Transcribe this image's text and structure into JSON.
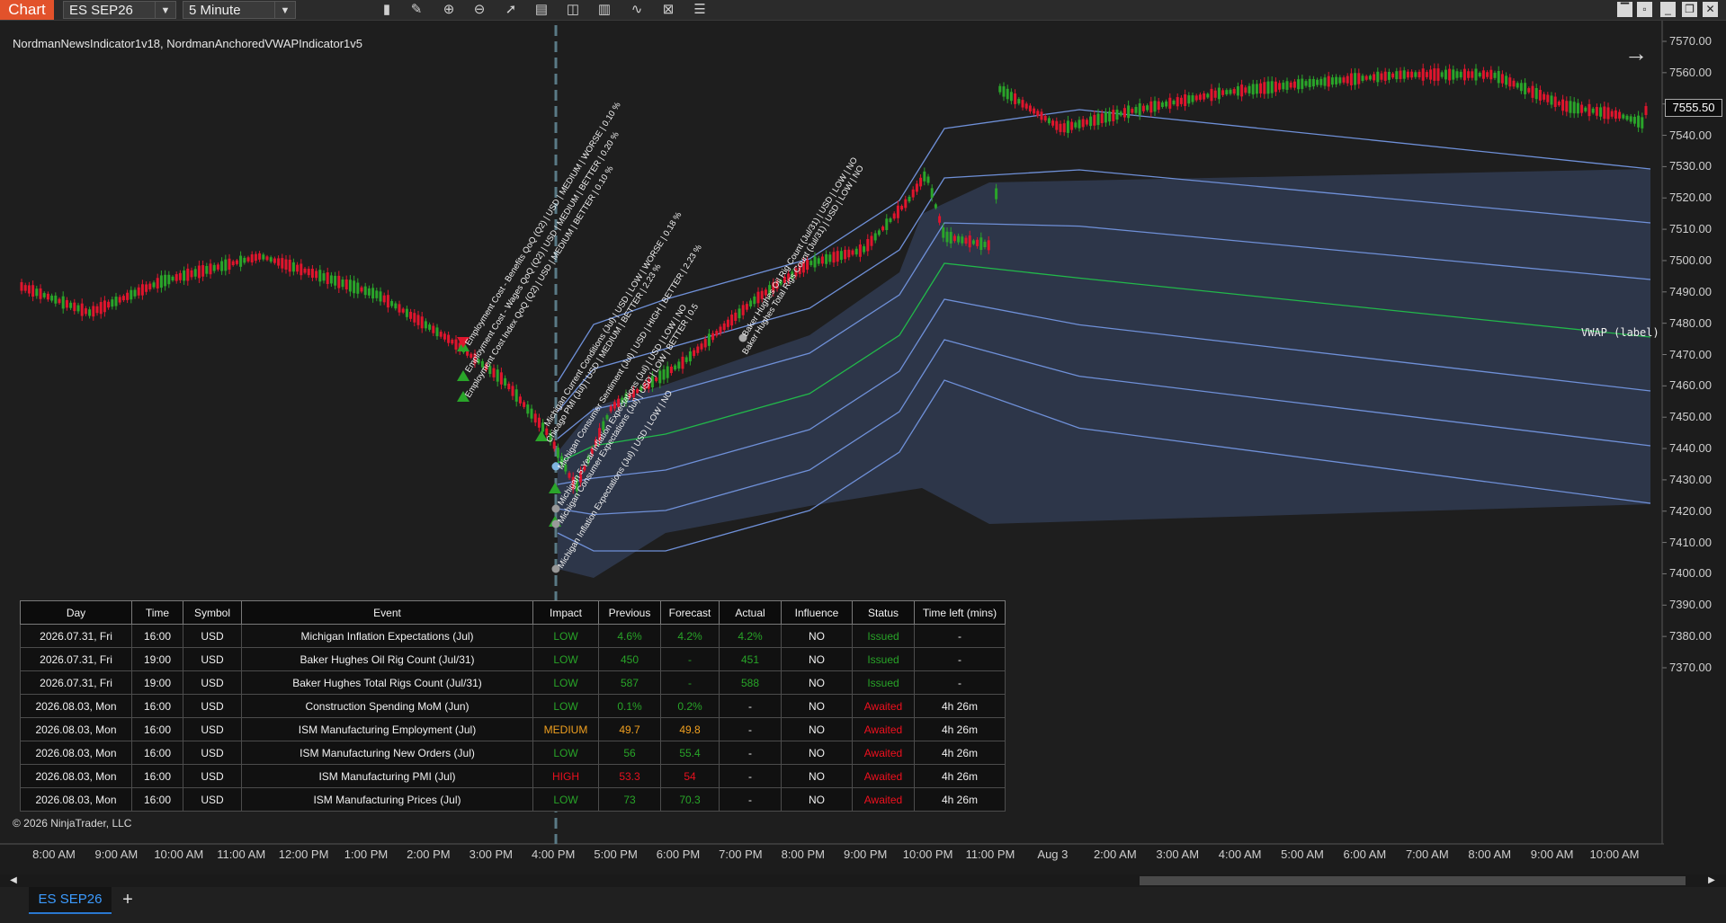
{
  "toolbar": {
    "app_tab": "Chart",
    "instrument": "ES SEP26",
    "interval": "5 Minute",
    "icons": [
      "bar-type-icon",
      "drawing-tool-icon",
      "zoom-in-icon",
      "zoom-out-icon",
      "pointer-icon",
      "data-box-icon",
      "chart-style-icon",
      "indicators-icon",
      "strategies-icon",
      "templates-icon",
      "properties-icon"
    ],
    "window_icons": [
      "minimize-icon",
      "restore-icon",
      "maximize-icon",
      "close-icon"
    ]
  },
  "chart": {
    "indicator_label": "NordmanNewsIndicator1v18, NordmanAnchoredVWAPIndicator1v5",
    "copyright": "© 2026 NinjaTrader, LLC",
    "vwap_label": "VWAP (label)",
    "last_price": "7555.50",
    "up_color": "#2aa52a",
    "down_color": "#e0152d",
    "price_ticks": [
      "7570.00",
      "7560.00",
      "7550.00",
      "7540.00",
      "7530.00",
      "7520.00",
      "7510.00",
      "7500.00",
      "7490.00",
      "7480.00",
      "7470.00",
      "7460.00",
      "7450.00",
      "7440.00",
      "7430.00",
      "7420.00",
      "7410.00",
      "7400.00",
      "7390.00",
      "7380.00",
      "7370.00"
    ],
    "time_ticks": [
      "8:00 AM",
      "9:00 AM",
      "10:00 AM",
      "11:00 AM",
      "12:00 PM",
      "1:00 PM",
      "2:00 PM",
      "3:00 PM",
      "4:00 PM",
      "5:00 PM",
      "6:00 PM",
      "7:00 PM",
      "8:00 PM",
      "9:00 PM",
      "10:00 PM",
      "11:00 PM",
      "Aug 3",
      "2:00 AM",
      "3:00 AM",
      "4:00 AM",
      "5:00 AM",
      "6:00 AM",
      "7:00 AM",
      "8:00 AM",
      "9:00 AM",
      "10:00 AM"
    ],
    "news_annotations": [
      "Employment Cost - Benefits QoQ (Q2) | USD | MEDIUM | WORSE | 0.10 %",
      "Employment Cost - Wages QoQ (Q2) | USD | MEDIUM | BETTER | 0.20 %",
      "Employment Cost Index QoQ (Q2) | USD | MEDIUM | BETTER | 0.10 %",
      "Michigan Current Conditions (Jul) | USD | LOW | WORSE | 0.18 %",
      "Chicago PMI (Jul) | USD | MEDIUM | BETTER | 2.23 %",
      "Michigan Consumer Sentiment (Jul) | USD | HIGH | BETTER | 2.23 %",
      "Michigan 5-Year Inflation Expectations (Jul) | USD | LOW | NO",
      "Michigan Consumer Expectations (Jul) | USD | LOW | BETTER | 0.5",
      "Michigan Inflation Expectations (Jul) | USD | LOW | NO",
      "Baker Hughes Oil Rig Count (Jul/31) | USD | LOW | NO",
      "Baker Hughes Total Rigs Count (Jul/31) | USD | LOW | NO"
    ]
  },
  "table": {
    "headers": [
      "Day",
      "Time",
      "Symbol",
      "Event",
      "Impact",
      "Previous",
      "Forecast",
      "Actual",
      "Influence",
      "Status",
      "Time left (mins)"
    ],
    "rows": [
      [
        "2026.07.31, Fri",
        "16:00",
        "USD",
        "Michigan Inflation Expectations (Jul)",
        "LOW",
        "4.6%",
        "4.2%",
        "4.2%",
        "NO",
        "Issued",
        "-"
      ],
      [
        "2026.07.31, Fri",
        "19:00",
        "USD",
        "Baker Hughes Oil Rig Count (Jul/31)",
        "LOW",
        "450",
        "-",
        "451",
        "NO",
        "Issued",
        "-"
      ],
      [
        "2026.07.31, Fri",
        "19:00",
        "USD",
        "Baker Hughes Total Rigs Count (Jul/31)",
        "LOW",
        "587",
        "-",
        "588",
        "NO",
        "Issued",
        "-"
      ],
      [
        "2026.08.03, Mon",
        "16:00",
        "USD",
        "Construction Spending MoM (Jun)",
        "LOW",
        "0.1%",
        "0.2%",
        "-",
        "NO",
        "Awaited",
        "4h 26m"
      ],
      [
        "2026.08.03, Mon",
        "16:00",
        "USD",
        "ISM Manufacturing Employment (Jul)",
        "MEDIUM",
        "49.7",
        "49.8",
        "-",
        "NO",
        "Awaited",
        "4h 26m"
      ],
      [
        "2026.08.03, Mon",
        "16:00",
        "USD",
        "ISM Manufacturing New Orders (Jul)",
        "LOW",
        "56",
        "55.4",
        "-",
        "NO",
        "Awaited",
        "4h 26m"
      ],
      [
        "2026.08.03, Mon",
        "16:00",
        "USD",
        "ISM Manufacturing PMI (Jul)",
        "HIGH",
        "53.3",
        "54",
        "-",
        "NO",
        "Awaited",
        "4h 26m"
      ],
      [
        "2026.08.03, Mon",
        "16:00",
        "USD",
        "ISM Manufacturing Prices (Jul)",
        "LOW",
        "73",
        "70.3",
        "-",
        "NO",
        "Awaited",
        "4h 26m"
      ]
    ],
    "impact_colors": {
      "LOW": "#28a428",
      "MEDIUM": "#f0a020",
      "HIGH": "#e8101e"
    },
    "status_colors": {
      "Issued": "#28a428",
      "Awaited": "#f0101e"
    }
  },
  "bottom": {
    "tab_label": "ES SEP26",
    "add_tab": "+"
  }
}
